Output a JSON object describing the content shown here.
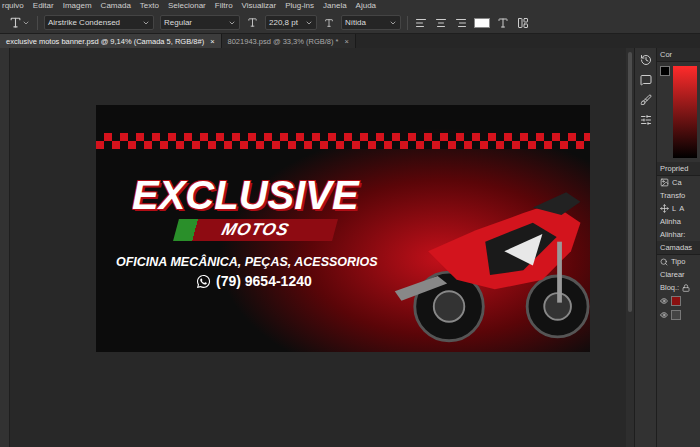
{
  "menu": [
    "rquivo",
    "Editar",
    "Imagem",
    "Camada",
    "Texto",
    "Selecionar",
    "Filtro",
    "Visualizar",
    "Plug-ins",
    "Janela",
    "Ajuda"
  ],
  "options_bar": {
    "font_family": "Airstrike Condensed",
    "font_style": "Regular",
    "font_size": "220,8 pt",
    "antialias": "Nítida"
  },
  "tabs": [
    {
      "label": "exclusive motos banner.psd @ 9,14% (Camada 5, RGB/8#)",
      "close": "×",
      "selected": true
    },
    {
      "label": "8021943.psd @ 33,3% (RGB/8) *",
      "close": "×",
      "selected": false
    }
  ],
  "canvas": {
    "title": "EXCLUSIVE",
    "subtitle": "MOTOS",
    "services": "OFICINA MECÂNICA, PEÇAS, ACESSORIOS",
    "phone": "(79) 9654-1240"
  },
  "panels": {
    "color_tab": "Cor",
    "properties": "Propried",
    "properties_item": "Ca",
    "transform": "Transfo",
    "transform_labels": [
      "L",
      "A"
    ],
    "align": "Alinha",
    "align_label": "Alinhar:",
    "layers": "Camadas",
    "layer_filter": "Tipo",
    "blend_mode": "Clarear",
    "lock_label": "Bloq.:"
  }
}
